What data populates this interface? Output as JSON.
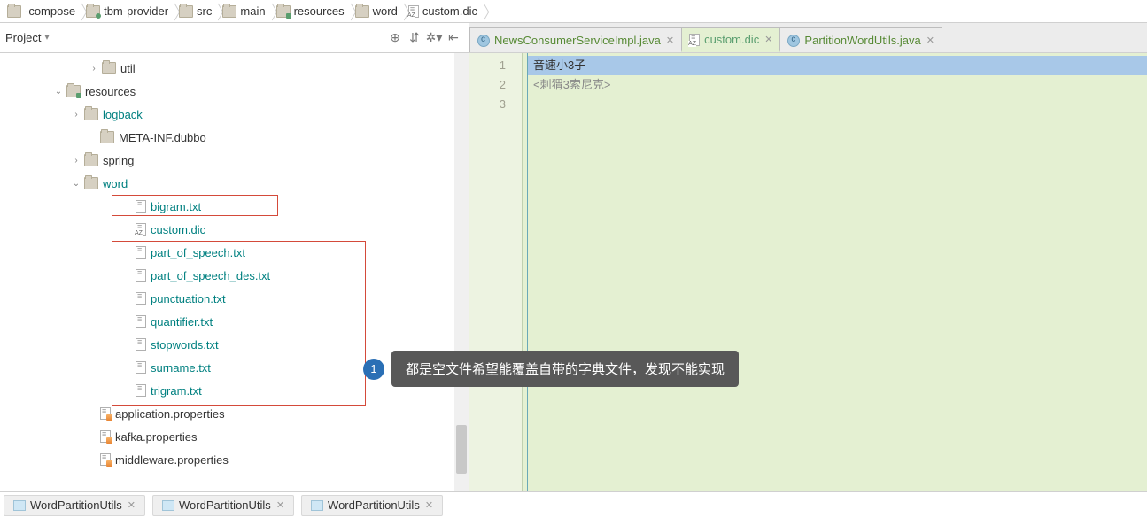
{
  "breadcrumb": [
    {
      "label": "-compose",
      "icon": "folder"
    },
    {
      "label": "tbm-provider",
      "icon": "folder src"
    },
    {
      "label": "src",
      "icon": "folder"
    },
    {
      "label": "main",
      "icon": "folder"
    },
    {
      "label": "resources",
      "icon": "folder res"
    },
    {
      "label": "word",
      "icon": "folder"
    },
    {
      "label": "custom.dic",
      "icon": "file dic"
    }
  ],
  "project_panel": {
    "title": "Project"
  },
  "tabs": [
    {
      "name": "NewsConsumerServiceImpl.java",
      "icon": "file java",
      "active": false
    },
    {
      "name": "custom.dic",
      "icon": "file dic",
      "active": true
    },
    {
      "name": "PartitionWordUtils.java",
      "icon": "file java",
      "active": false
    }
  ],
  "tree": [
    {
      "indent": 100,
      "arrow": ">",
      "icon": "folder",
      "label": "util",
      "teal": false
    },
    {
      "indent": 60,
      "arrow": "v",
      "icon": "folder res",
      "label": "resources",
      "teal": false
    },
    {
      "indent": 80,
      "arrow": ">",
      "icon": "folder",
      "label": "logback",
      "teal": true
    },
    {
      "indent": 98,
      "arrow": "",
      "icon": "folder",
      "label": "META-INF.dubbo",
      "teal": false
    },
    {
      "indent": 80,
      "arrow": ">",
      "icon": "folder",
      "label": "spring",
      "teal": false
    },
    {
      "indent": 80,
      "arrow": "v",
      "icon": "folder",
      "label": "word",
      "teal": true
    },
    {
      "indent": 138,
      "arrow": "",
      "icon": "file",
      "label": "bigram.txt",
      "teal": true
    },
    {
      "indent": 138,
      "arrow": "",
      "icon": "file dic",
      "label": "custom.dic",
      "teal": true
    },
    {
      "indent": 138,
      "arrow": "",
      "icon": "file",
      "label": "part_of_speech.txt",
      "teal": true
    },
    {
      "indent": 138,
      "arrow": "",
      "icon": "file",
      "label": "part_of_speech_des.txt",
      "teal": true
    },
    {
      "indent": 138,
      "arrow": "",
      "icon": "file",
      "label": "punctuation.txt",
      "teal": true
    },
    {
      "indent": 138,
      "arrow": "",
      "icon": "file",
      "label": "quantifier.txt",
      "teal": true
    },
    {
      "indent": 138,
      "arrow": "",
      "icon": "file",
      "label": "stopwords.txt",
      "teal": true
    },
    {
      "indent": 138,
      "arrow": "",
      "icon": "file",
      "label": "surname.txt",
      "teal": true
    },
    {
      "indent": 138,
      "arrow": "",
      "icon": "file",
      "label": "trigram.txt",
      "teal": true
    },
    {
      "indent": 98,
      "arrow": "",
      "icon": "file prop",
      "label": "application.properties",
      "teal": false
    },
    {
      "indent": 98,
      "arrow": "",
      "icon": "file prop",
      "label": "kafka.properties",
      "teal": false
    },
    {
      "indent": 98,
      "arrow": "",
      "icon": "file prop",
      "label": "middleware.properties",
      "teal": false
    }
  ],
  "editor": {
    "lines": [
      {
        "n": "1",
        "text": "音速小3子",
        "sel": true
      },
      {
        "n": "2",
        "text": "<刺猬3索尼克>",
        "gray": true
      },
      {
        "n": "3",
        "text": ""
      }
    ]
  },
  "callout": {
    "num": "1",
    "text": "都是空文件希望能覆盖自带的字典文件，发现不能实现"
  },
  "bottom_tabs": [
    {
      "label": "WordPartitionUtils"
    },
    {
      "label": "WordPartitionUtils"
    },
    {
      "label": "WordPartitionUtils"
    }
  ]
}
